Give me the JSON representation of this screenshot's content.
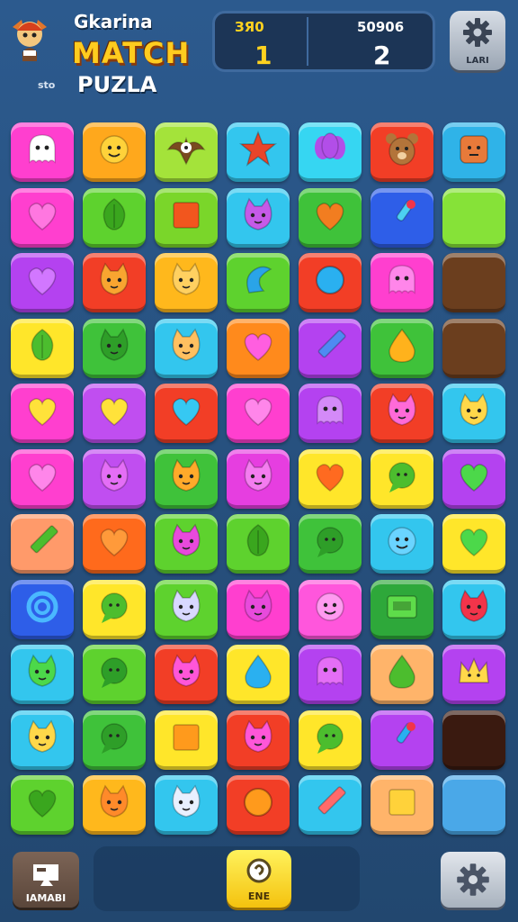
{
  "header": {
    "title_small": "Gkarina",
    "title_big": "MATCH",
    "subtag": "sto",
    "title_sub": "PUZLA",
    "logo_icon": "winged-mascot-icon"
  },
  "scores": [
    {
      "label": "ЗЯ0",
      "value": "1",
      "label_color": "#ffd21f"
    },
    {
      "label": "50906",
      "value": "2",
      "label_color": "#ffffff"
    }
  ],
  "top_button": {
    "label": "LARI",
    "icon": "gear-icon"
  },
  "bottom": {
    "left_label": "IAMABI",
    "left_icon": "flag-icon",
    "middle_label": "ENE",
    "middle_icon": "hint-icon",
    "right_icon": "gear-icon"
  },
  "board": {
    "rows": 11,
    "cols": 7,
    "tiles": [
      [
        {
          "c": "#ff3fcf",
          "i": "ghost",
          "s": "#ffffff"
        },
        {
          "c": "#ffa81c",
          "i": "face",
          "s": "#ffd23a"
        },
        {
          "c": "#a4e33a",
          "i": "eagle",
          "s": "#7a4a20"
        },
        {
          "c": "#33c6ee",
          "i": "star",
          "s": "#e8452a"
        },
        {
          "c": "#36d6f2",
          "i": "balloon",
          "s": "#b24ee8"
        },
        {
          "c": "#f23e26",
          "i": "bear",
          "s": "#b3743a"
        },
        {
          "c": "#2fb3e8",
          "i": "block",
          "s": "#e77a3a"
        }
      ],
      [
        {
          "c": "#ff3fcf",
          "i": "heart",
          "s": "#ff77e0"
        },
        {
          "c": "#5ed22e",
          "i": "leaf",
          "s": "#3aa61e"
        },
        {
          "c": "#7ad62a",
          "i": "square",
          "s": "#f2561e"
        },
        {
          "c": "#33c6ee",
          "i": "cat",
          "s": "#c55ae8"
        },
        {
          "c": "#3fc23a",
          "i": "heart",
          "s": "#f27d20"
        },
        {
          "c": "#2e5ee8",
          "i": "paint",
          "s": "#4cd0f2"
        },
        {
          "c": "#86e238",
          "i": "none",
          "s": "#86e238"
        }
      ],
      [
        {
          "c": "#b442f0",
          "i": "heart",
          "s": "#d277ff"
        },
        {
          "c": "#f23e26",
          "i": "cat",
          "s": "#f8a530"
        },
        {
          "c": "#ffb81c",
          "i": "cat",
          "s": "#ffd060"
        },
        {
          "c": "#5ed22e",
          "i": "hook",
          "s": "#2aa4e8"
        },
        {
          "c": "#f23e26",
          "i": "circle",
          "s": "#2ab0f0"
        },
        {
          "c": "#ff3fcf",
          "i": "ghost",
          "s": "#ff86ea"
        },
        {
          "c": "#6b3e1e",
          "i": "none",
          "s": "#6b3e1e"
        }
      ],
      [
        {
          "c": "#ffe62a",
          "i": "leaf",
          "s": "#4cbd2e"
        },
        {
          "c": "#3fc23a",
          "i": "cat",
          "s": "#2e9e28"
        },
        {
          "c": "#33c6ee",
          "i": "cat",
          "s": "#ffc060"
        },
        {
          "c": "#ff8a1c",
          "i": "heart",
          "s": "#ff5ee0"
        },
        {
          "c": "#b442f0",
          "i": "pencil",
          "s": "#4e8af2"
        },
        {
          "c": "#3fc23a",
          "i": "drop",
          "s": "#ffb21c"
        },
        {
          "c": "#6b3e1e",
          "i": "none",
          "s": "#6b3e1e"
        }
      ],
      [
        {
          "c": "#ff3fcf",
          "i": "heart",
          "s": "#ffe23a"
        },
        {
          "c": "#c04ef0",
          "i": "heart",
          "s": "#ffe23a"
        },
        {
          "c": "#f23e26",
          "i": "heart",
          "s": "#36c8f2"
        },
        {
          "c": "#ff3fcf",
          "i": "heart",
          "s": "#ff86ea"
        },
        {
          "c": "#b442f0",
          "i": "ghost",
          "s": "#d48af8"
        },
        {
          "c": "#f23e26",
          "i": "cat",
          "s": "#ff6ad8"
        },
        {
          "c": "#33c6ee",
          "i": "cat",
          "s": "#ffd84a"
        }
      ],
      [
        {
          "c": "#ff3fcf",
          "i": "heart",
          "s": "#ff86ea"
        },
        {
          "c": "#c04ef0",
          "i": "cat",
          "s": "#e46ef6"
        },
        {
          "c": "#3fc23a",
          "i": "cat",
          "s": "#ffaa2a"
        },
        {
          "c": "#e63ee0",
          "i": "cat",
          "s": "#f47cf0"
        },
        {
          "c": "#ffe62a",
          "i": "heart",
          "s": "#ff6a20"
        },
        {
          "c": "#ffe62a",
          "i": "bubble",
          "s": "#4cbd2e"
        },
        {
          "c": "#b442f0",
          "i": "heart",
          "s": "#4cd84a"
        }
      ],
      [
        {
          "c": "#ff9a6a",
          "i": "pencil",
          "s": "#4cbd2e"
        },
        {
          "c": "#ff6a1c",
          "i": "heart",
          "s": "#ff9a3a"
        },
        {
          "c": "#5ed22e",
          "i": "cat",
          "s": "#e84adc"
        },
        {
          "c": "#5ed22e",
          "i": "leaf",
          "s": "#3aa61e"
        },
        {
          "c": "#3fc23a",
          "i": "bubble",
          "s": "#2e9e28"
        },
        {
          "c": "#33c6ee",
          "i": "face",
          "s": "#6ad4ff"
        },
        {
          "c": "#ffe62a",
          "i": "heart",
          "s": "#4cd84a"
        }
      ],
      [
        {
          "c": "#2e5ee8",
          "i": "swirl",
          "s": "#4ab8ff"
        },
        {
          "c": "#ffe62a",
          "i": "bubble",
          "s": "#4cbd2e"
        },
        {
          "c": "#5ed22e",
          "i": "cat",
          "s": "#d8d8ff"
        },
        {
          "c": "#ff3fcf",
          "i": "cat",
          "s": "#e84adc"
        },
        {
          "c": "#ff56dc",
          "i": "face",
          "s": "#ff9af0"
        },
        {
          "c": "#2ea83a",
          "i": "chest",
          "s": "#5edc4a"
        },
        {
          "c": "#33c6ee",
          "i": "cat",
          "s": "#f2344a"
        }
      ],
      [
        {
          "c": "#33c6ee",
          "i": "cat",
          "s": "#4cd84a"
        },
        {
          "c": "#5ed22e",
          "i": "bubble",
          "s": "#2e9e28"
        },
        {
          "c": "#f23e26",
          "i": "cat",
          "s": "#ff56d8"
        },
        {
          "c": "#ffe62a",
          "i": "drop",
          "s": "#2ab0f0"
        },
        {
          "c": "#b442f0",
          "i": "ghost",
          "s": "#e46ef6"
        },
        {
          "c": "#ffb46a",
          "i": "drop",
          "s": "#4cbd2e"
        },
        {
          "c": "#b442f0",
          "i": "crown",
          "s": "#ffd84a"
        }
      ],
      [
        {
          "c": "#33c6ee",
          "i": "cat",
          "s": "#ffd84a"
        },
        {
          "c": "#3fc23a",
          "i": "bubble",
          "s": "#2e9e28"
        },
        {
          "c": "#ffe62a",
          "i": "square",
          "s": "#ff9a1c"
        },
        {
          "c": "#f23e26",
          "i": "cat",
          "s": "#ff56d8"
        },
        {
          "c": "#ffe62a",
          "i": "bubble",
          "s": "#4cbd2e"
        },
        {
          "c": "#b442f0",
          "i": "paint",
          "s": "#2ab0f0"
        },
        {
          "c": "#3a1a10",
          "i": "none",
          "s": "#3a1a10"
        }
      ],
      [
        {
          "c": "#5ed22e",
          "i": "heart",
          "s": "#3aa61e"
        },
        {
          "c": "#ffb81c",
          "i": "cat",
          "s": "#ff8a2a"
        },
        {
          "c": "#33c6ee",
          "i": "cat",
          "s": "#e8f0ff"
        },
        {
          "c": "#f23e26",
          "i": "circle",
          "s": "#ff9a1c"
        },
        {
          "c": "#33c6ee",
          "i": "pencil",
          "s": "#ff6a6a"
        },
        {
          "c": "#ffb46a",
          "i": "square",
          "s": "#ffd23a"
        },
        {
          "c": "#4aa8e8",
          "i": "none",
          "s": "#4aa8e8"
        }
      ]
    ]
  }
}
